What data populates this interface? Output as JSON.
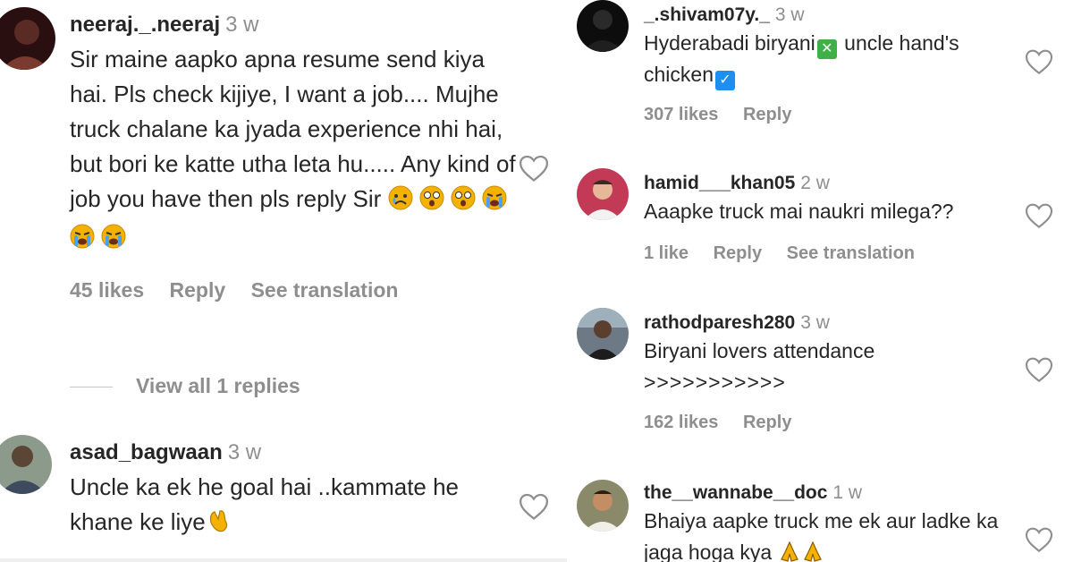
{
  "left": {
    "comments": [
      {
        "username": "neeraj._.neeraj",
        "time": "3 w",
        "text": "Sir maine aapko apna resume send kiya hai. Pls check kijiye, I want a job.... Mujhe truck chalane ka jyada experience nhi hai, but bori ke katte utha leta hu..... Any kind of job you have then pls reply Sir",
        "emojis": [
          "sad-face",
          "dizzy-face",
          "dizzy-face",
          "crying-face",
          "crying-face",
          "crying-face"
        ],
        "likes": "45 likes",
        "reply": "Reply",
        "translate": "See translation",
        "view_replies": "View all 1 replies"
      },
      {
        "username": "asad_bagwaan",
        "time": "3 w",
        "text": "Uncle ka ek he goal hai ..kammate he khane ke liye",
        "emojis": [
          "clapping-hands"
        ]
      }
    ]
  },
  "right": {
    "comments": [
      {
        "username": "_.shivam07y._",
        "time": "3 w",
        "text_a": "Hyderabadi biryani",
        "text_b": " uncle hand's",
        "text_c": "chicken",
        "marks": [
          "cross-mark",
          "check-mark"
        ],
        "likes": "307 likes",
        "reply": "Reply"
      },
      {
        "username": "hamid___khan05",
        "time": "2 w",
        "text": "Aaapke truck mai naukri milega??",
        "likes": "1 like",
        "reply": "Reply",
        "translate": "See translation"
      },
      {
        "username": "rathodparesh280",
        "time": "3 w",
        "text": "Biryani lovers attendance",
        "text_2": ">>>>>>>>>>>",
        "likes": "162 likes",
        "reply": "Reply"
      },
      {
        "username": "the__wannabe__doc",
        "time": "1 w",
        "text": "Bhaiya aapke truck me ek aur ladke ka jaga hoga kya",
        "emojis": [
          "praying-hands",
          "praying-hands"
        ]
      }
    ]
  },
  "colors": {
    "text": "#262626",
    "secondary": "#8e8e8e",
    "check_green": "#3fb045",
    "check_blue": "#1d8ff0",
    "emoji_yellow": "#f5b100"
  }
}
